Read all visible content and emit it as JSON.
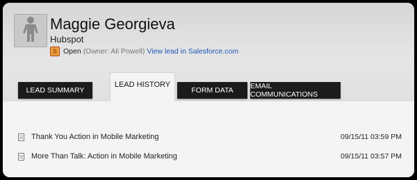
{
  "lead": {
    "name": "Maggie Georgieva",
    "company": "Hubspot",
    "status": "Open",
    "owner": "(Owner: Ali Powell)",
    "salesforce_link": "View lead in Salesforce.com",
    "salesforce_icon": "salesforce-s-icon",
    "avatar_icon": "person-silhouette-icon"
  },
  "tabs": [
    {
      "label": "LEAD SUMMARY",
      "active": false
    },
    {
      "label": "LEAD HISTORY",
      "active": true
    },
    {
      "label": "FORM DATA",
      "active": false
    },
    {
      "label": "EMAIL COMMUNICATIONS",
      "active": false
    }
  ],
  "history": [
    {
      "title": "Thank You Action in Mobile Marketing",
      "date": "09/15/11 03:59 PM",
      "icon": "document-icon"
    },
    {
      "title": "More Than Talk: Action in Mobile Marketing",
      "date": "09/15/11 03:57 PM",
      "icon": "document-icon"
    }
  ],
  "colors": {
    "link": "#1f57b8",
    "tab_dark": "#1b1b1b",
    "tab_active": "#f4f4f4",
    "header_bg": "#dcdcdc",
    "salesforce_orange": "#e8a23a"
  }
}
